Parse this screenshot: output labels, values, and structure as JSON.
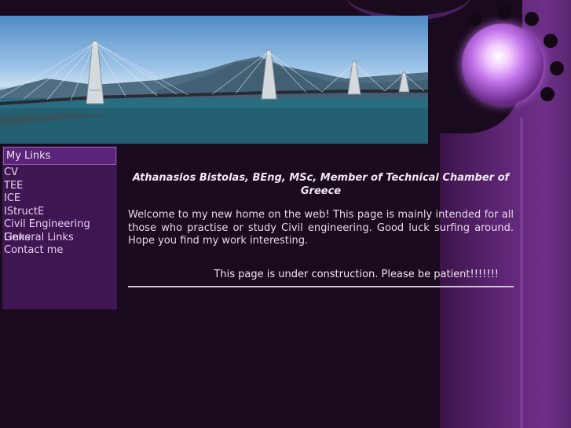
{
  "sidebar": {
    "header": "My Links",
    "links": [
      "CV",
      "TEE",
      "ICE",
      "IStructE",
      "Civil Engineering Links",
      "General Links",
      "Contact me"
    ]
  },
  "main": {
    "title": "Athanasios Bistolas, BEng, MSc, Member of Technical Chamber of Greece",
    "intro": "Welcome to my new home on the web! This page is mainly intended for all those who practise or study Civil engineering. Good luck surfing around. Hope you find my work interesting.",
    "construction": "This page is under construction. Please be patient!!!!!!!"
  },
  "colors": {
    "background": "#1a0a1e",
    "frame": "#5a2470",
    "sidebar": "#3e1652",
    "sidebar_header": "#5a2478",
    "orb": "#c070e8"
  }
}
